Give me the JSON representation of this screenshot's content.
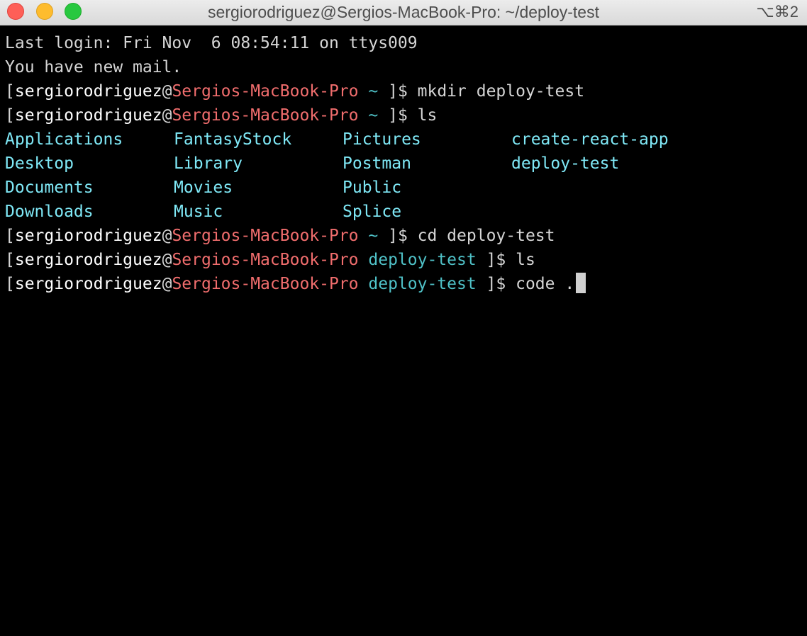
{
  "window": {
    "title": "sergiorodriguez@Sergios-MacBook-Pro: ~/deploy-test",
    "shortcut": "⌥⌘2"
  },
  "terminal": {
    "login_line": "Last login: Fri Nov  6 08:54:11 on ttys009",
    "mail_line": "You have new mail.",
    "prompts": [
      {
        "open": "[",
        "user": "sergiorodriguez",
        "at": "@",
        "host": "Sergios-MacBook-Pro",
        "dir": " ~ ",
        "close": "]$ ",
        "command": "mkdir deploy-test"
      },
      {
        "open": "[",
        "user": "sergiorodriguez",
        "at": "@",
        "host": "Sergios-MacBook-Pro",
        "dir": " ~ ",
        "close": "]$ ",
        "command": "ls"
      },
      {
        "open": "[",
        "user": "sergiorodriguez",
        "at": "@",
        "host": "Sergios-MacBook-Pro",
        "dir": " ~ ",
        "close": "]$ ",
        "command": "cd deploy-test"
      },
      {
        "open": "[",
        "user": "sergiorodriguez",
        "at": "@",
        "host": "Sergios-MacBook-Pro",
        "dir": " deploy-test ",
        "close": "]$ ",
        "command": "ls"
      },
      {
        "open": "[",
        "user": "sergiorodriguez",
        "at": "@",
        "host": "Sergios-MacBook-Pro",
        "dir": " deploy-test ",
        "close": "]$ ",
        "command": "code ."
      }
    ],
    "ls_rows": [
      [
        "Applications",
        "FantasyStock",
        "Pictures",
        "create-react-app"
      ],
      [
        "Desktop",
        "Library",
        "Postman",
        "deploy-test"
      ],
      [
        "Documents",
        "Movies",
        "Public",
        ""
      ],
      [
        "Downloads",
        "Music",
        "Splice",
        ""
      ]
    ]
  },
  "colors": {
    "user": "#ffffff",
    "host": "#f06d6d",
    "dir": "#4fc1c7",
    "ls_entry": "#7fe8f6",
    "text": "#d5d5d5",
    "background": "#000000"
  }
}
